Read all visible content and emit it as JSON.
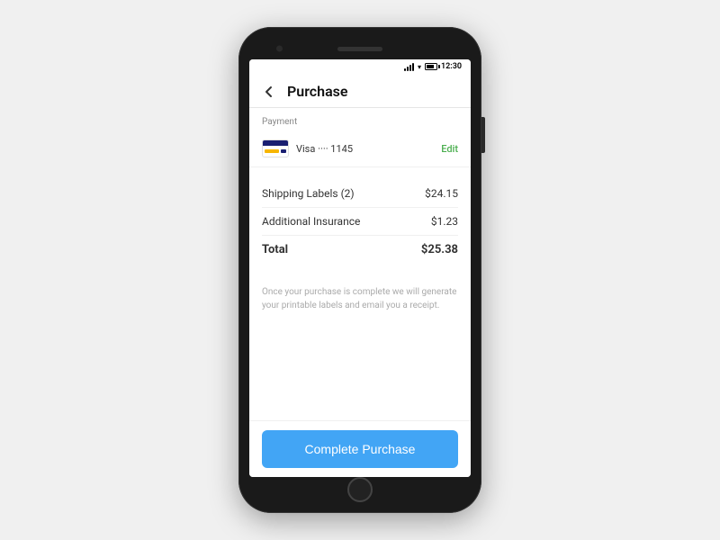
{
  "statusBar": {
    "time": "12:30",
    "batteryLevel": "80"
  },
  "header": {
    "title": "Purchase",
    "backLabel": "←"
  },
  "payment": {
    "sectionLabel": "Payment",
    "cardName": "Visa ···· 1145",
    "editLabel": "Edit"
  },
  "orderItems": [
    {
      "label": "Shipping Labels (2)",
      "value": "$24.15"
    },
    {
      "label": "Additional Insurance",
      "value": "$1.23"
    }
  ],
  "total": {
    "label": "Total",
    "value": "$25.38"
  },
  "receiptNote": "Once your purchase is complete we will generate your printable labels and email you a receipt.",
  "completePurchase": {
    "label": "Complete Purchase"
  }
}
